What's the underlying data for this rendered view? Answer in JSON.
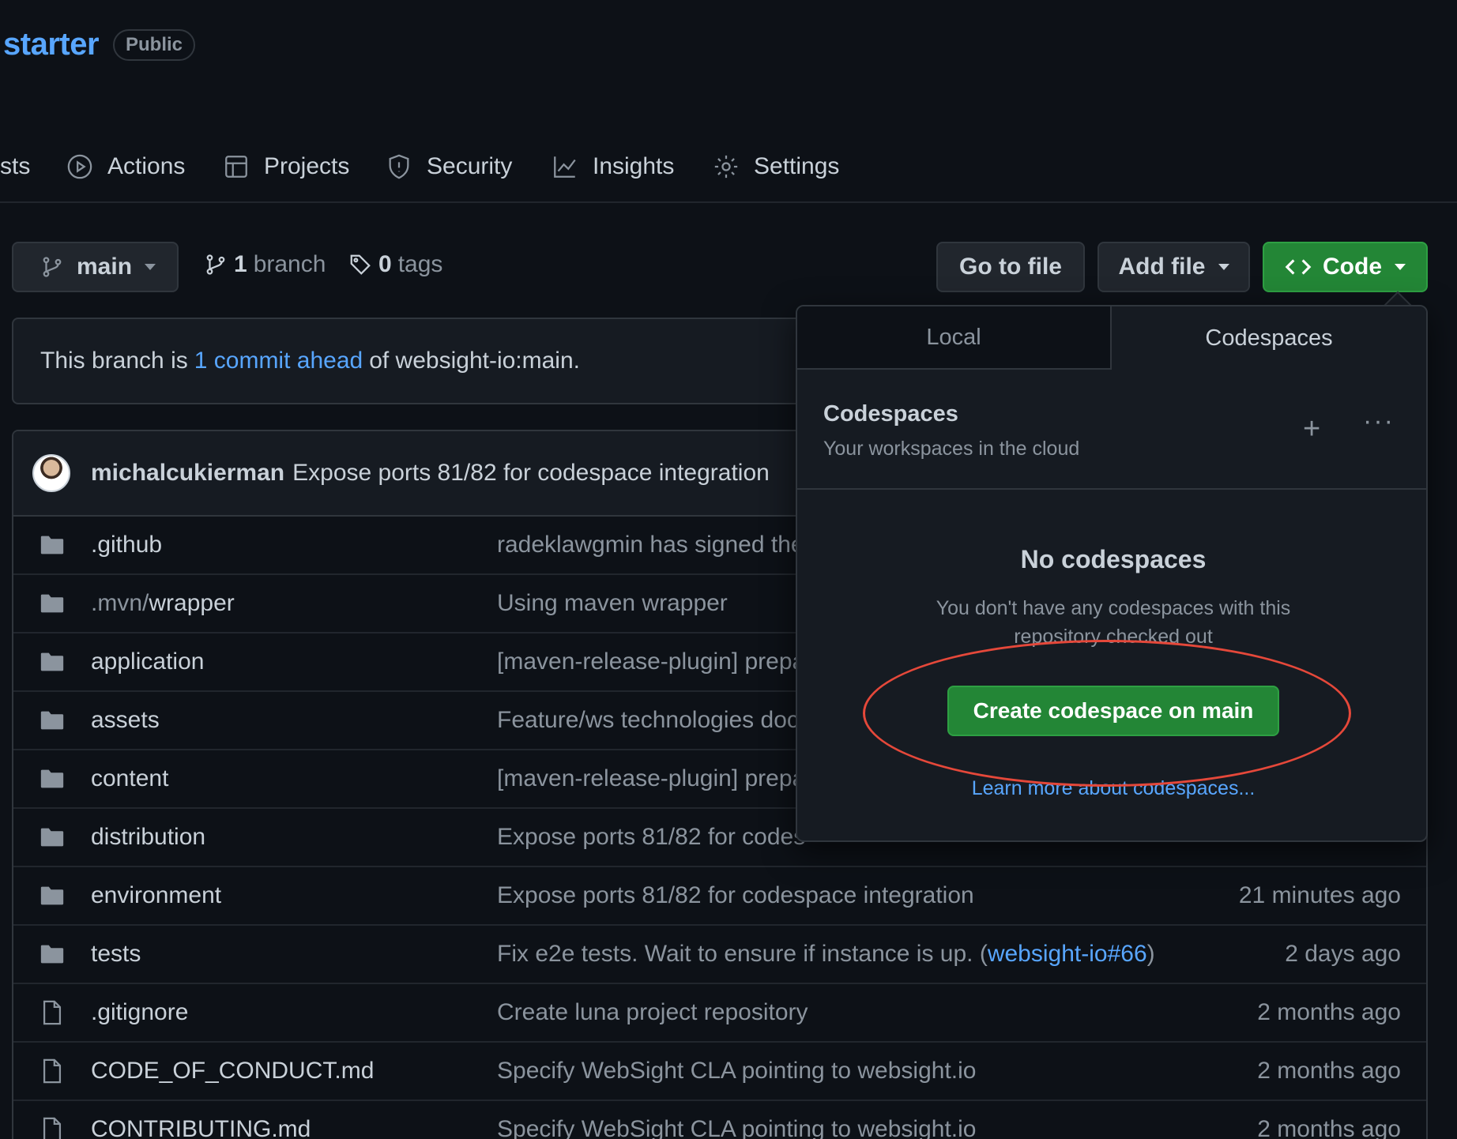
{
  "repo": {
    "name": "starter",
    "visibility": "Public"
  },
  "tabs": [
    {
      "label": "sts",
      "icon": "pull-request-icon"
    },
    {
      "label": "Actions",
      "icon": "play-circle-icon"
    },
    {
      "label": "Projects",
      "icon": "table-icon"
    },
    {
      "label": "Security",
      "icon": "shield-icon"
    },
    {
      "label": "Insights",
      "icon": "graph-icon"
    },
    {
      "label": "Settings",
      "icon": "gear-icon"
    }
  ],
  "toolbar": {
    "branch": "main",
    "branch_count": "1",
    "branch_label": "branch",
    "tag_count": "0",
    "tag_label": "tags",
    "go_to_file": "Go to file",
    "add_file": "Add file",
    "code": "Code"
  },
  "notice": {
    "prefix": "This branch is",
    "link": "1 commit ahead",
    "suffix": "of websight-io:main."
  },
  "latest_commit": {
    "author": "michalcukierman",
    "message": "Expose ports 81/82 for codespace integration"
  },
  "files": [
    {
      "type": "dir",
      "name": ".github",
      "commit": "radeklawgmin has signed the",
      "time": ""
    },
    {
      "type": "dir",
      "name": ".mvn/",
      "name2": "wrapper",
      "commit": "Using maven wrapper",
      "time": ""
    },
    {
      "type": "dir",
      "name": "application",
      "commit": "[maven-release-plugin] prepa",
      "time": ""
    },
    {
      "type": "dir",
      "name": "assets",
      "commit": "Feature/ws technologies doc",
      "time": ""
    },
    {
      "type": "dir",
      "name": "content",
      "commit": "[maven-release-plugin] prepa",
      "time": ""
    },
    {
      "type": "dir",
      "name": "distribution",
      "commit": "Expose ports 81/82 for codes",
      "time": ""
    },
    {
      "type": "dir",
      "name": "environment",
      "commit": "Expose ports 81/82 for codespace integration",
      "time": "21 minutes ago"
    },
    {
      "type": "dir",
      "name": "tests",
      "commit": "Fix e2e tests. Wait to ensure if instance is up. (",
      "commit_link": "websight-io#66",
      "commit_after": ")",
      "time": "2 days ago"
    },
    {
      "type": "file",
      "name": ".gitignore",
      "commit": "Create luna project repository",
      "time": "2 months ago"
    },
    {
      "type": "file",
      "name": "CODE_OF_CONDUCT.md",
      "commit": "Specify WebSight CLA pointing to websight.io",
      "time": "2 months ago"
    },
    {
      "type": "file",
      "name": "CONTRIBUTING.md",
      "commit": "Specify WebSight CLA pointing to websight.io",
      "time": "2 months ago"
    }
  ],
  "popover": {
    "tab_local": "Local",
    "tab_codespaces": "Codespaces",
    "title": "Codespaces",
    "subtitle": "Your workspaces in the cloud",
    "plus": "+",
    "more": "···",
    "empty_title": "No codespaces",
    "empty_text": "You don't have any codespaces with this repository checked out",
    "create_button": "Create codespace on main",
    "learn_more": "Learn more about codespaces..."
  },
  "colors": {
    "accent": "#58a6ff",
    "green": "#238636",
    "highlight": "#e5483a",
    "background": "#0d1117"
  }
}
